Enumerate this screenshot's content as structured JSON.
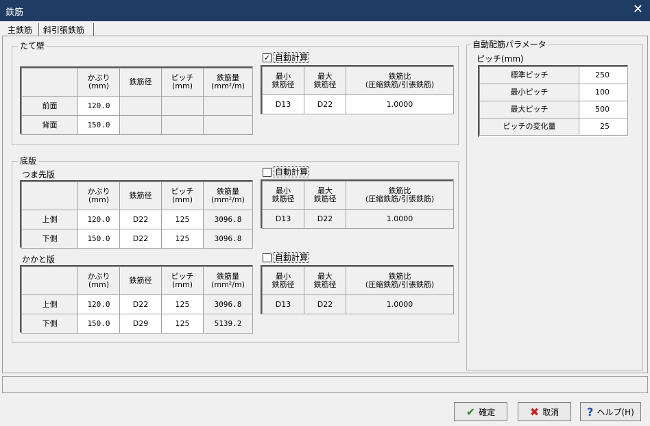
{
  "window": {
    "title": "鉄筋",
    "close_glyph": "✕"
  },
  "tabs": [
    {
      "label": "主鉄筋"
    },
    {
      "label": "斜引張鉄筋"
    }
  ],
  "main": {
    "wall": {
      "label": "たて壁",
      "headers": {
        "cover": "かぶり\n(mm)",
        "dia": "鉄筋径",
        "pitch": "ピッチ\n(mm)",
        "area": "鉄筋量\n(mm²/m)"
      },
      "rows": [
        {
          "label": "前面",
          "cover": "120.0",
          "dia": "",
          "pitch": "",
          "area": ""
        },
        {
          "label": "背面",
          "cover": "150.0",
          "dia": "",
          "pitch": "",
          "area": ""
        }
      ],
      "auto": {
        "checked": true,
        "check_glyph": "✓",
        "label": "自動計算",
        "h_min": "最小\n鉄筋径",
        "h_max": "最大\n鉄筋径",
        "h_ratio": "鉄筋比\n(圧縮鉄筋/引張鉄筋)",
        "min": "D13",
        "max": "D22",
        "ratio": "1.0000"
      }
    },
    "base": {
      "label": "底版",
      "toe": {
        "label": "つま先版",
        "rows": [
          {
            "label": "上側",
            "cover": "120.0",
            "dia": "D22",
            "pitch": "125",
            "area": "3096.8"
          },
          {
            "label": "下側",
            "cover": "150.0",
            "dia": "D22",
            "pitch": "125",
            "area": "3096.8"
          }
        ],
        "auto": {
          "checked": false,
          "label": "自動計算",
          "min": "D13",
          "max": "D22",
          "ratio": "1.0000"
        }
      },
      "heel": {
        "label": "かかと版",
        "rows": [
          {
            "label": "上側",
            "cover": "120.0",
            "dia": "D22",
            "pitch": "125",
            "area": "3096.8"
          },
          {
            "label": "下側",
            "cover": "150.0",
            "dia": "D29",
            "pitch": "125",
            "area": "5139.2"
          }
        ],
        "auto": {
          "checked": false,
          "label": "自動計算",
          "min": "D13",
          "max": "D22",
          "ratio": "1.0000"
        }
      }
    },
    "params": {
      "label": "自動配筋パラメータ",
      "sublabel": "ピッチ(mm)",
      "rows": [
        {
          "label": "標準ピッチ",
          "value": "250"
        },
        {
          "label": "最小ピッチ",
          "value": "100"
        },
        {
          "label": "最大ピッチ",
          "value": "500"
        },
        {
          "label": "ピッチの変化量",
          "value": "25"
        }
      ]
    }
  },
  "buttons": {
    "ok": {
      "label": "確定",
      "icon": "✔"
    },
    "cancel": {
      "label": "取消",
      "icon": "✖"
    },
    "help": {
      "label": "ヘルプ(H)",
      "icon": "?"
    }
  },
  "colors": {
    "titlebar": "#1f3d62",
    "ok": "#2a8a2a",
    "cancel": "#c62020",
    "help": "#1a4fb5"
  }
}
